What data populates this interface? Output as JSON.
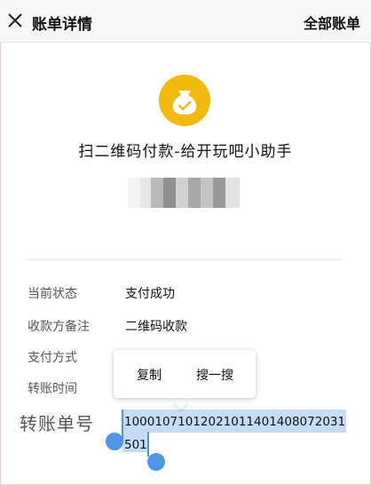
{
  "header": {
    "close_icon": "close-icon",
    "title": "账单详情",
    "all_bills": "全部账单"
  },
  "merchant": {
    "icon": "money-bag-icon",
    "icon_color": "#f2b90f",
    "name": "扫二维码付款-给开玩吧小助手"
  },
  "details": {
    "status_label": "当前状态",
    "status_value": "支付成功",
    "payee_note_label": "收款方备注",
    "payee_note_value": "二维码收款",
    "payment_method_label": "支付方式",
    "transfer_time_label": "转账时间",
    "order_number_label": "转账单号",
    "order_number_value": "10001071012021011401408072031501"
  },
  "context_menu": {
    "copy": "复制",
    "search": "搜一搜"
  },
  "colors": {
    "selection": "#c5dcf4",
    "handle": "#4f95e8"
  }
}
